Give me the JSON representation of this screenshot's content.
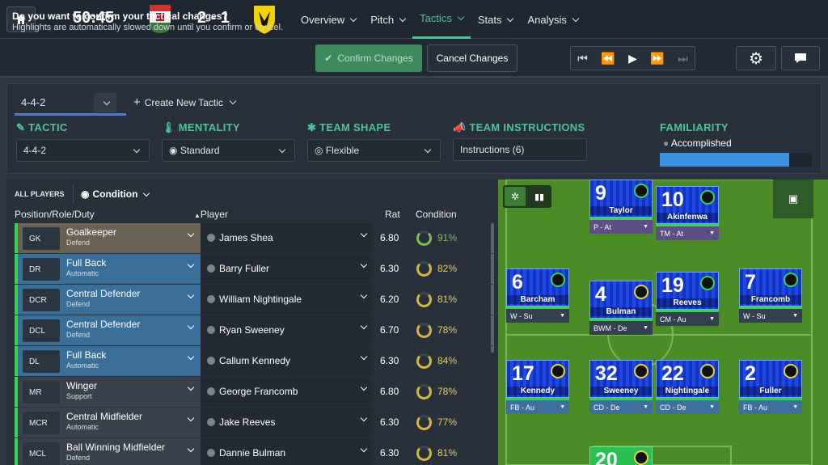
{
  "match": {
    "clock": "50:45",
    "score": "2 - 1"
  },
  "nav": [
    {
      "label": "Overview"
    },
    {
      "label": "Pitch"
    },
    {
      "label": "Tactics",
      "active": true
    },
    {
      "label": "Stats"
    },
    {
      "label": "Analysis"
    }
  ],
  "confirm": {
    "question": "Do you want to confirm your tactical changes?",
    "hint": "Highlights are automatically slowed down until you confirm or cancel.",
    "confirm_label": "Confirm Changes",
    "cancel_label": "Cancel Changes"
  },
  "tactic_bar": {
    "formation": "4-4-2",
    "create_label": "Create New Tactic"
  },
  "sections": {
    "tactic": {
      "label": "TACTIC",
      "value": "4-4-2"
    },
    "mentality": {
      "label": "MENTALITY",
      "value": "Standard"
    },
    "team_shape": {
      "label": "TEAM SHAPE",
      "value": "Flexible"
    },
    "instructions": {
      "label": "TEAM INSTRUCTIONS",
      "value": "Instructions (6)"
    },
    "familiarity": {
      "label": "FAMILIARITY",
      "value": "Accomplished",
      "level": 0.85
    }
  },
  "table": {
    "filter_label": "ALL PLAYERS",
    "condition_filter": "Condition",
    "headers": {
      "position": "Position/Role/Duty",
      "player": "Player",
      "rat": "Rat",
      "condition": "Condition"
    },
    "rows": [
      {
        "code": "GK",
        "role": "Goalkeeper",
        "duty": "Defend",
        "player": "James Shea",
        "rat": "6.80",
        "condition": "91%"
      },
      {
        "code": "DR",
        "role": "Full Back",
        "duty": "Automatic",
        "player": "Barry Fuller",
        "rat": "6.30",
        "condition": "82%"
      },
      {
        "code": "DCR",
        "role": "Central Defender",
        "duty": "Defend",
        "player": "William Nightingale",
        "rat": "6.20",
        "condition": "81%"
      },
      {
        "code": "DCL",
        "role": "Central Defender",
        "duty": "Defend",
        "player": "Ryan Sweeney",
        "rat": "6.70",
        "condition": "78%"
      },
      {
        "code": "DL",
        "role": "Full Back",
        "duty": "Automatic",
        "player": "Callum Kennedy",
        "rat": "6.30",
        "condition": "84%"
      },
      {
        "code": "MR",
        "role": "Winger",
        "duty": "Support",
        "player": "George Francomb",
        "rat": "6.80",
        "condition": "78%"
      },
      {
        "code": "MCR",
        "role": "Central Midfielder",
        "duty": "Automatic",
        "player": "Jake Reeves",
        "rat": "6.30",
        "condition": "77%"
      },
      {
        "code": "MCL",
        "role": "Ball Winning Midfielder",
        "duty": "Defend",
        "player": "Dannie Bulman",
        "rat": "6.30",
        "condition": "81%"
      }
    ]
  },
  "pitch_cards": [
    {
      "num": "9",
      "name": "Taylor",
      "role": "P - At"
    },
    {
      "num": "10",
      "name": "Akinfenwa",
      "role": "TM - At"
    },
    {
      "num": "6",
      "name": "Barcham",
      "role": "W - Su"
    },
    {
      "num": "4",
      "name": "Bulman",
      "role": "BWM - De"
    },
    {
      "num": "19",
      "name": "Reeves",
      "role": "CM - Au"
    },
    {
      "num": "7",
      "name": "Francomb",
      "role": "W - Su"
    },
    {
      "num": "17",
      "name": "Kennedy",
      "role": "FB - Au"
    },
    {
      "num": "32",
      "name": "Sweeney",
      "role": "CD - De"
    },
    {
      "num": "22",
      "name": "Nightingale",
      "role": "CD - De"
    },
    {
      "num": "2",
      "name": "Fuller",
      "role": "FB - Au"
    },
    {
      "num": "20",
      "name": "",
      "role": ""
    }
  ],
  "colors": {
    "accent": "#4cc39a",
    "defender_row": "#3a6f9a",
    "gk_row": "#6b6152",
    "mid_row": "#39424c"
  }
}
